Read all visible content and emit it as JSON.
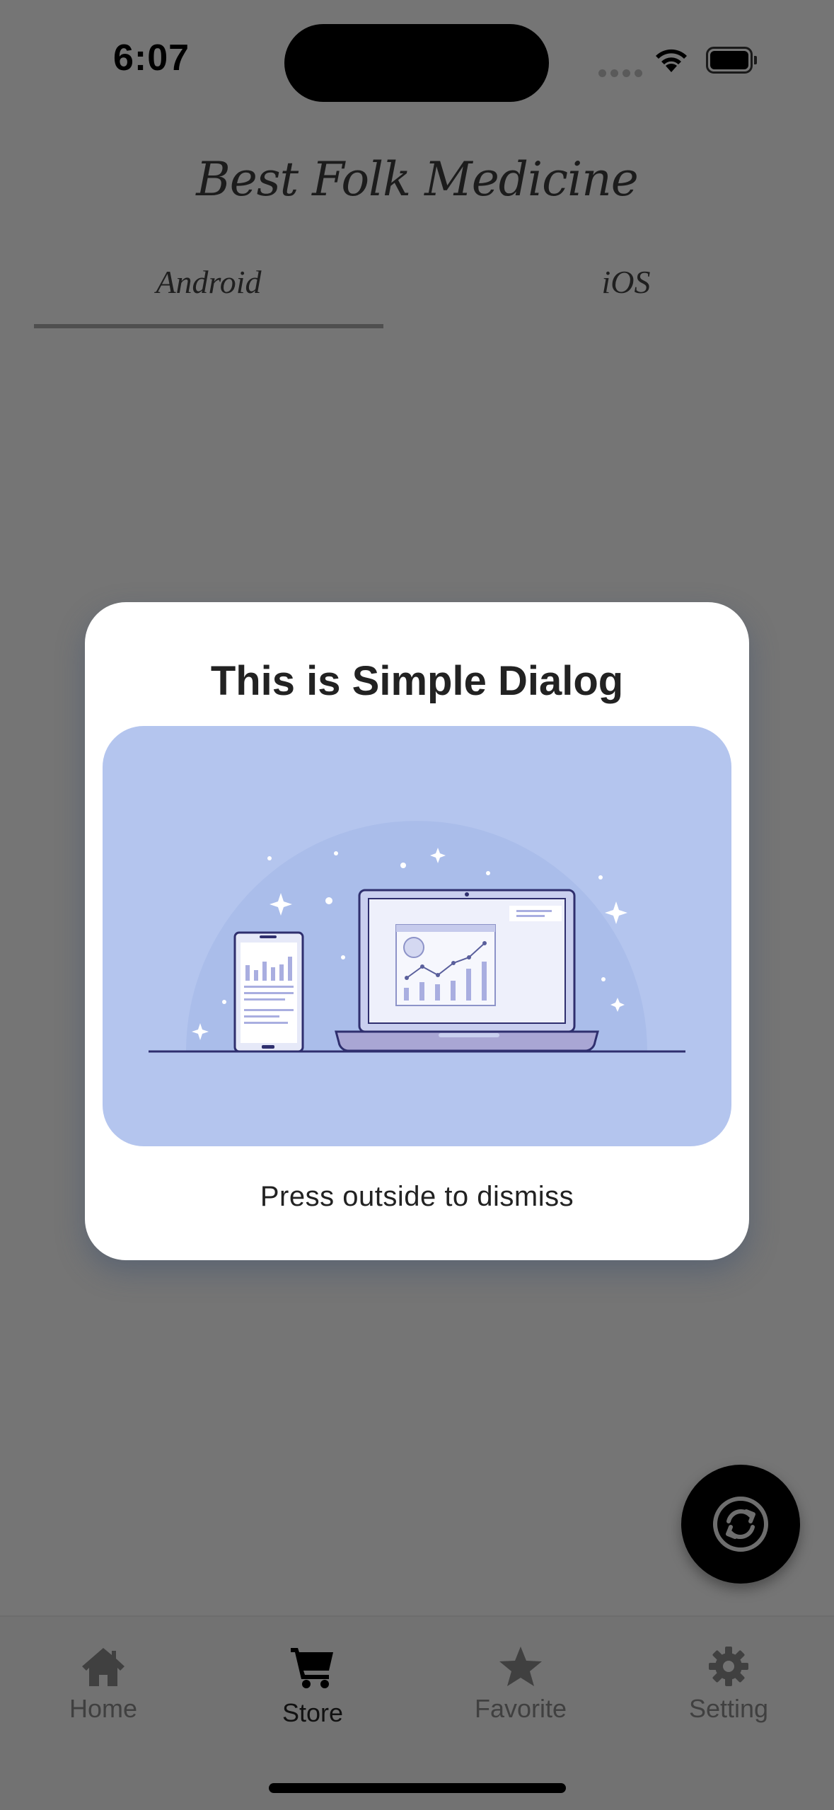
{
  "status_bar": {
    "time": "6:07",
    "icons": [
      "signal-icon",
      "wifi-icon",
      "battery-icon"
    ]
  },
  "header": {
    "title": "Best Folk Medicine"
  },
  "tabs": [
    {
      "label": "Android",
      "active": true
    },
    {
      "label": "iOS",
      "active": false
    }
  ],
  "dialog": {
    "title": "This is Simple Dialog",
    "hint": "Press outside to dismiss",
    "illustration": "devices-analytics-illustration"
  },
  "fab": {
    "icon": "sync-icon"
  },
  "bottom_nav": {
    "items": [
      {
        "label": "Home",
        "icon": "home-icon",
        "active": false
      },
      {
        "label": "Store",
        "icon": "cart-icon",
        "active": true
      },
      {
        "label": "Favorite",
        "icon": "star-icon",
        "active": false
      },
      {
        "label": "Setting",
        "icon": "gear-icon",
        "active": false
      }
    ]
  },
  "colors": {
    "overlay_background": "#757575",
    "dialog_background": "#ffffff",
    "illustration_background": "#b4c5ee",
    "fab_background": "#000000"
  }
}
